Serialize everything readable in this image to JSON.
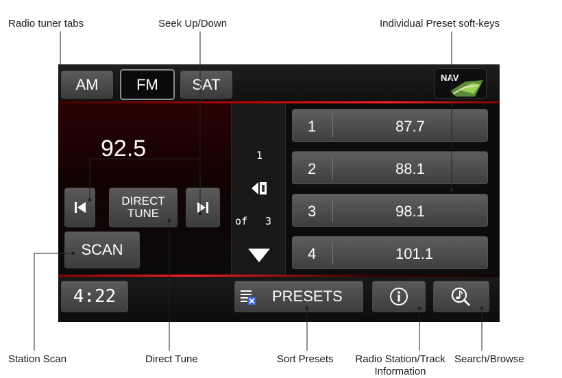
{
  "callouts": {
    "radio_tuner_tabs": "Radio tuner tabs",
    "seek_up_down": "Seek Up/Down",
    "individual_preset_softkeys": "Individual Preset soft-keys",
    "station_scan": "Station Scan",
    "direct_tune": "Direct Tune",
    "sort_presets": "Sort Presets",
    "radio_station_info_line1": "Radio Station/Track",
    "radio_station_info_line2": "Information",
    "search_browse": "Search/Browse"
  },
  "tabs": [
    {
      "label": "AM",
      "active": false
    },
    {
      "label": "FM",
      "active": true
    },
    {
      "label": "SAT",
      "active": false
    }
  ],
  "nav_button_label": "NAV",
  "frequency": "92.5",
  "direct_tune_line1": "DIRECT",
  "direct_tune_line2": "TUNE",
  "scan_label": "SCAN",
  "clock": "4:22",
  "page_current": "1",
  "page_of_label": "of",
  "page_total": "3",
  "presets": [
    {
      "number": "1",
      "frequency": "87.7"
    },
    {
      "number": "2",
      "frequency": "88.1"
    },
    {
      "number": "3",
      "frequency": "98.1"
    },
    {
      "number": "4",
      "frequency": "101.1"
    }
  ],
  "presets_button_label": "PRESETS",
  "icons": {
    "seek_down": "skip-previous-icon",
    "seek_up": "skip-next-icon",
    "page_back": "page-back-icon",
    "page_down": "triangle-down-icon",
    "sort": "sort-list-icon",
    "info": "info-circle-icon",
    "search": "music-search-icon",
    "nav": "map-icon"
  },
  "colors": {
    "accent_red": "#ff2020",
    "button_gray": "#4a4a4a",
    "screen_bg": "#0c0c0c"
  }
}
